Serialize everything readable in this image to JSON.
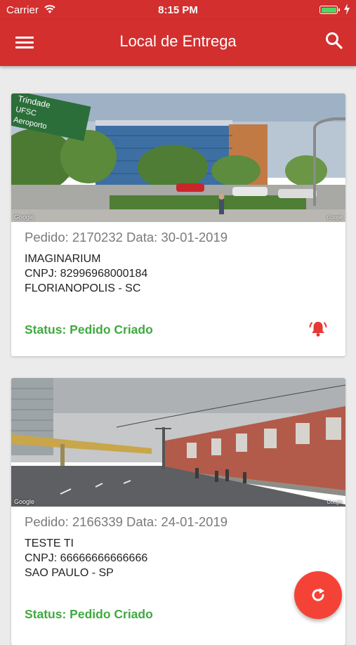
{
  "status_bar": {
    "carrier": "Carrier",
    "time": "8:15 PM"
  },
  "app_bar": {
    "title": "Local de Entrega",
    "menu_icon": "menu-icon",
    "search_icon": "search-icon"
  },
  "colors": {
    "primary": "#d32f2f",
    "status_green": "#3faa3f",
    "bell_red": "#e53935",
    "fab": "#f44336"
  },
  "orders": [
    {
      "pedido": "Pedido: 2170232 Data: 30-01-2019",
      "name": "IMAGINARIUM",
      "cnpj": "CNPJ: 82996968000184",
      "city": "FLORIANOPOLIS - SC",
      "status": "Status: Pedido Criado",
      "photo_credit": "Google",
      "sign_line_1": "Trindade",
      "sign_line_2": "UFSC",
      "sign_line_3": "Aeroporto"
    },
    {
      "pedido": "Pedido: 2166339 Data: 24-01-2019",
      "name": "TESTE TI",
      "cnpj": "CNPJ: 66666666666666",
      "city": "SAO PAULO - SP",
      "status": "Status: Pedido Criado",
      "photo_credit": "Google"
    }
  ],
  "fab_icon": "refresh-icon"
}
